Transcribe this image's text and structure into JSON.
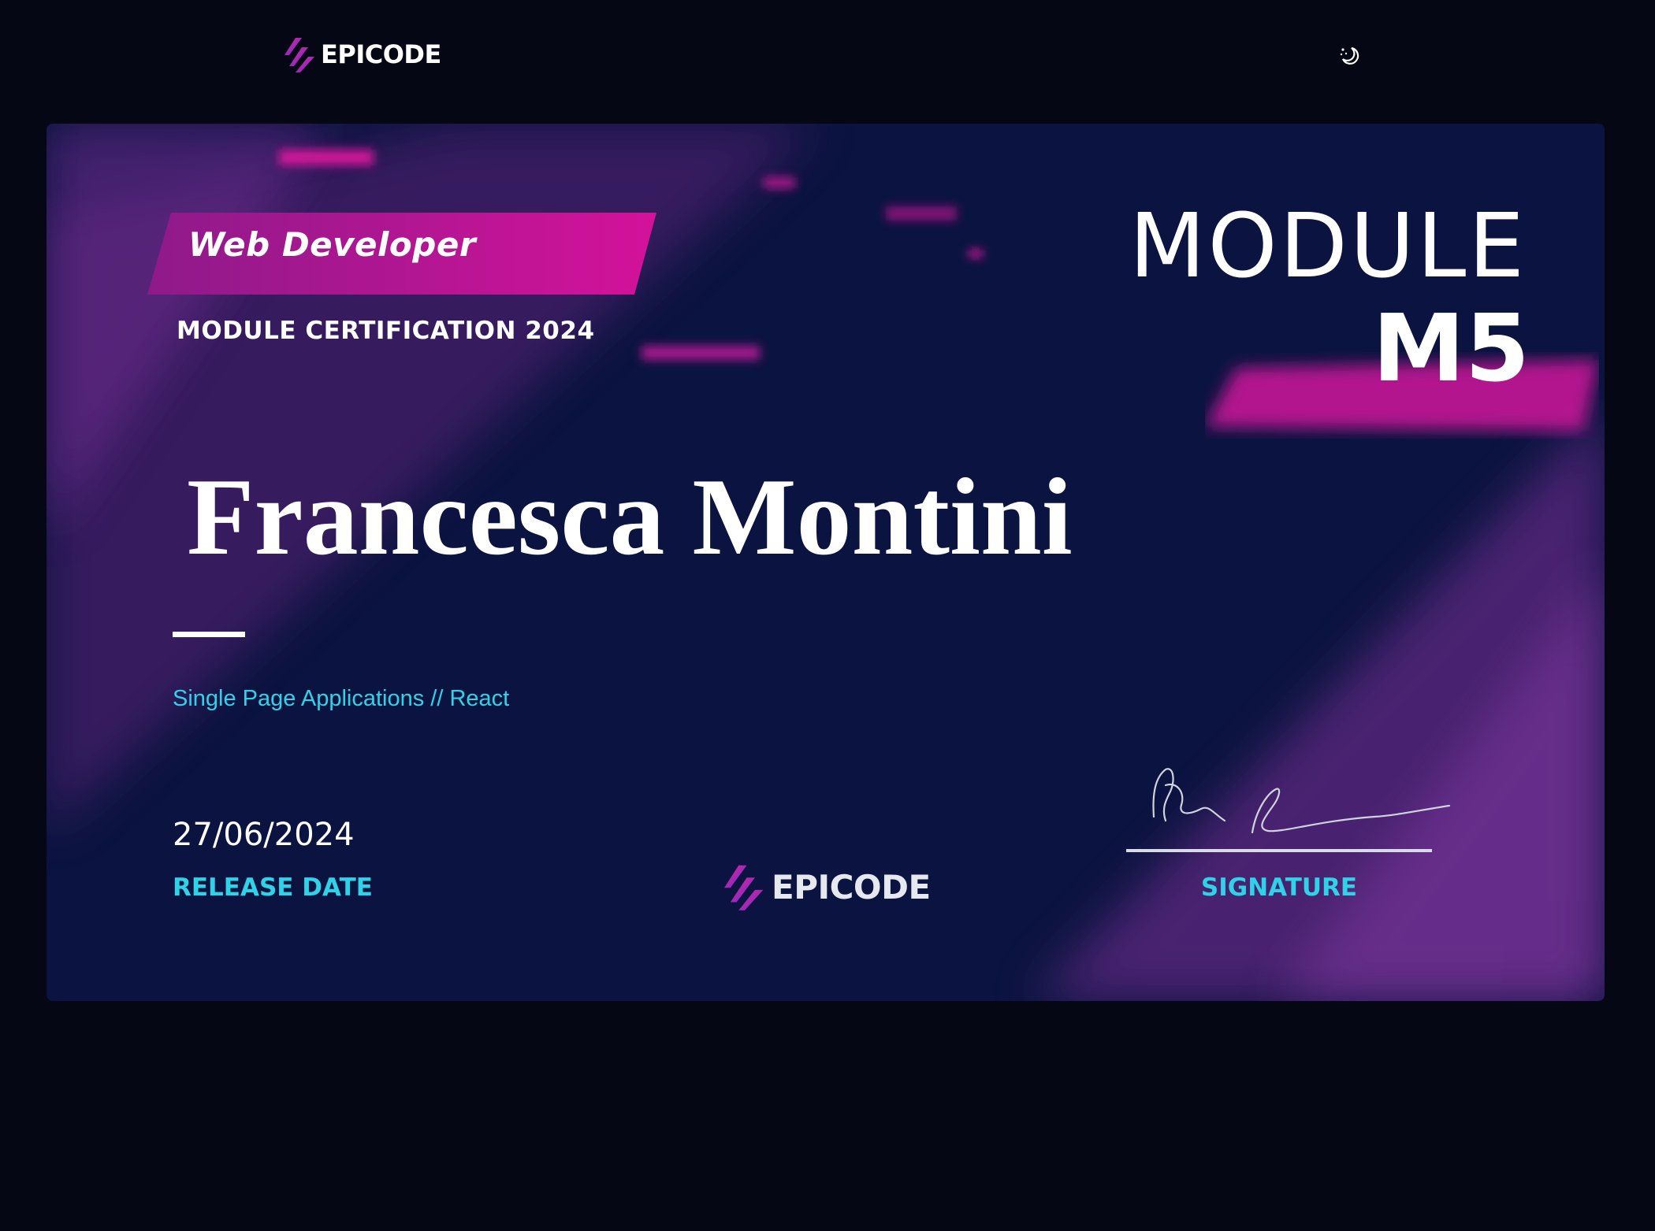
{
  "header": {
    "logo_text": "EPICODE",
    "theme_toggle_icon": "moon-stars-icon"
  },
  "certificate": {
    "role": "Web Developer",
    "subtitle": "MODULE CERTIFICATION 2024",
    "module_word": "MODULE",
    "module_code": "M5",
    "recipient_name": "Francesca Montini",
    "course": "Single Page Applications // React",
    "release_date": "27/06/2024",
    "release_date_label": "RELEASE DATE",
    "logo_text": "EPICODE",
    "signature_label": "SIGNATURE"
  },
  "colors": {
    "page_background": "#050814",
    "certificate_background": "#0b1440",
    "accent_magenta": "#c0159a",
    "accent_cyan": "#2fd3e8",
    "purple_glow": "#6a2a8a"
  }
}
